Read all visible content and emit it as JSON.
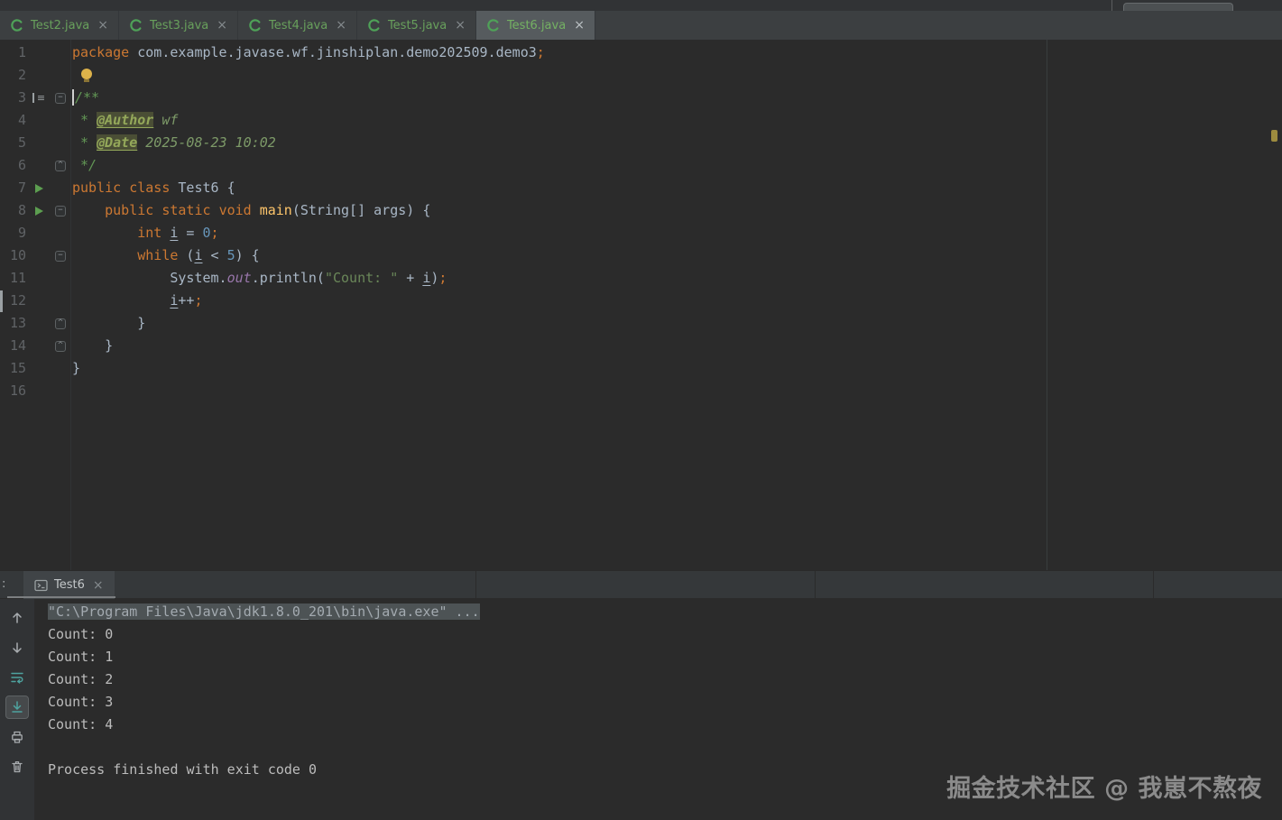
{
  "colors": {
    "keyword": "#cc7832",
    "plain_text": "#a9b7c6",
    "comment": "#629755",
    "string": "#6a8759",
    "number": "#6897bb",
    "run_arrow_green": "#5c9e50",
    "tab_label_green": "#68a05c",
    "editor_bg": "#2b2b2b",
    "panel_bg": "#3c3f41",
    "toolbar_teal": "#4ea39f"
  },
  "tab_bar": {
    "tabs": [
      {
        "label": "Test2.java",
        "close": "×",
        "active": false
      },
      {
        "label": "Test3.java",
        "close": "×",
        "active": false
      },
      {
        "label": "Test4.java",
        "close": "×",
        "active": false
      },
      {
        "label": "Test5.java",
        "close": "×",
        "active": false
      },
      {
        "label": "Test6.java",
        "close": "×",
        "active": true
      }
    ]
  },
  "editor": {
    "lines": [
      {
        "n": "1",
        "segs": [
          [
            "package",
            "kw"
          ],
          [
            " com.example.javase.wf.jinshiplan.demo202509.demo3",
            "plain"
          ],
          [
            ";",
            "semi"
          ]
        ]
      },
      {
        "n": "2",
        "segs": [],
        "bulb": true
      },
      {
        "n": "3",
        "segs": [
          [
            "/**",
            "comment"
          ]
        ],
        "caret": true,
        "comment_handle": true,
        "fold": "start"
      },
      {
        "n": "4",
        "segs": [
          [
            " * ",
            "comment"
          ],
          [
            "@Author",
            "doctag"
          ],
          [
            " wf",
            "docval"
          ]
        ]
      },
      {
        "n": "5",
        "segs": [
          [
            " * ",
            "comment"
          ],
          [
            "@Date",
            "doctag"
          ],
          [
            " 2025-08-23 10:02",
            "docval"
          ]
        ]
      },
      {
        "n": "6",
        "segs": [
          [
            " */",
            "comment"
          ]
        ],
        "fold": "end"
      },
      {
        "n": "7",
        "segs": [
          [
            "public",
            "kw"
          ],
          [
            " ",
            "plain"
          ],
          [
            "class",
            "kw"
          ],
          [
            " Test6 {",
            "plain"
          ]
        ],
        "run": true
      },
      {
        "n": "8",
        "segs": [
          [
            "    ",
            "plain"
          ],
          [
            "public",
            "kw"
          ],
          [
            " ",
            "plain"
          ],
          [
            "static",
            "kw"
          ],
          [
            " ",
            "plain"
          ],
          [
            "void",
            "kw"
          ],
          [
            " ",
            "plain"
          ],
          [
            "main",
            "method"
          ],
          [
            "(String[] args) {",
            "plain"
          ]
        ],
        "run": true,
        "fold": "start"
      },
      {
        "n": "9",
        "segs": [
          [
            "        ",
            "plain"
          ],
          [
            "int",
            "kw"
          ],
          [
            " ",
            "plain"
          ],
          [
            "i",
            "var"
          ],
          [
            " = ",
            "plain"
          ],
          [
            "0",
            "num"
          ],
          [
            ";",
            "semi"
          ]
        ]
      },
      {
        "n": "10",
        "segs": [
          [
            "        ",
            "plain"
          ],
          [
            "while",
            "kw"
          ],
          [
            " (",
            "plain"
          ],
          [
            "i",
            "var"
          ],
          [
            " < ",
            "plain"
          ],
          [
            "5",
            "num"
          ],
          [
            ") {",
            "plain"
          ]
        ],
        "fold": "start"
      },
      {
        "n": "11",
        "segs": [
          [
            "            System.",
            "plain"
          ],
          [
            "out",
            "field"
          ],
          [
            ".println(",
            "plain"
          ],
          [
            "\"Count: \"",
            "str"
          ],
          [
            " + ",
            "plain"
          ],
          [
            "i",
            "var"
          ],
          [
            ")",
            "plain"
          ],
          [
            ";",
            "semi"
          ]
        ]
      },
      {
        "n": "12",
        "segs": [
          [
            "            ",
            "plain"
          ],
          [
            "i",
            "var"
          ],
          [
            "++",
            "plain"
          ],
          [
            ";",
            "semi"
          ]
        ]
      },
      {
        "n": "13",
        "segs": [
          [
            "        }",
            "plain"
          ]
        ],
        "fold": "end"
      },
      {
        "n": "14",
        "segs": [
          [
            "    }",
            "plain"
          ]
        ],
        "fold": "end"
      },
      {
        "n": "15",
        "segs": [
          [
            "}",
            "plain"
          ]
        ]
      },
      {
        "n": "16",
        "segs": []
      }
    ]
  },
  "run_panel": {
    "prefix": ":",
    "tab": {
      "label": "Test6",
      "close": "×"
    },
    "toolbar": [
      {
        "name": "up-the-stack-trace",
        "icon": "arrow-up"
      },
      {
        "name": "down-the-stack-trace",
        "icon": "arrow-down"
      },
      {
        "name": "soft-wrap",
        "icon": "soft-wrap",
        "tint": "teal"
      },
      {
        "name": "scroll-to-end",
        "icon": "scroll-end",
        "tint": "teal",
        "selected": true
      },
      {
        "name": "print",
        "icon": "print"
      },
      {
        "name": "clear-all",
        "icon": "trash"
      }
    ],
    "console": {
      "command": "\"C:\\Program Files\\Java\\jdk1.8.0_201\\bin\\java.exe\" ...",
      "output": [
        "Count: 0",
        "Count: 1",
        "Count: 2",
        "Count: 3",
        "Count: 4",
        "",
        "Process finished with exit code 0"
      ]
    }
  },
  "watermark": "掘金技术社区 @ 我崽不熬夜"
}
